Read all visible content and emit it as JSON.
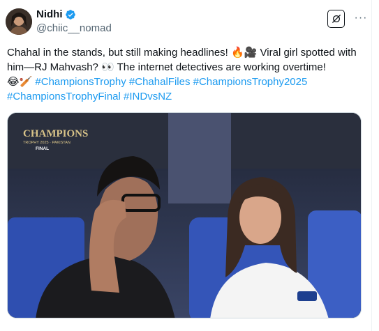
{
  "author": {
    "display_name": "Nidhi",
    "handle": "@chiic__nomad",
    "verified": true
  },
  "icons": {
    "verified": "verified-badge-icon",
    "grok": "grok-icon",
    "more": "more-options-icon"
  },
  "more_label": "···",
  "tweet": {
    "line1": "Chahal in the stands, but still making headlines! ",
    "emoji1": "🔥🎥",
    "line1b": " Viral girl spotted with him—RJ Mahvash? ",
    "emoji2": "👀",
    "line1c": " The internet detectives are working overtime!",
    "emoji3": "😂🏏",
    "hashtags": [
      "#ChampionsTrophy",
      "#ChahalFiles",
      "#ChampionsTrophy2025",
      "#ChampionsTrophyFinal",
      "#INDvsNZ"
    ]
  },
  "media": {
    "overlay_title": "CHAMPIONS",
    "overlay_sub": "TROPHY 2025 · PAKISTAN",
    "overlay_final": "FINAL"
  },
  "colors": {
    "link": "#1d9bf0",
    "verified": "#1d9bf0",
    "secondary_text": "#536471"
  }
}
